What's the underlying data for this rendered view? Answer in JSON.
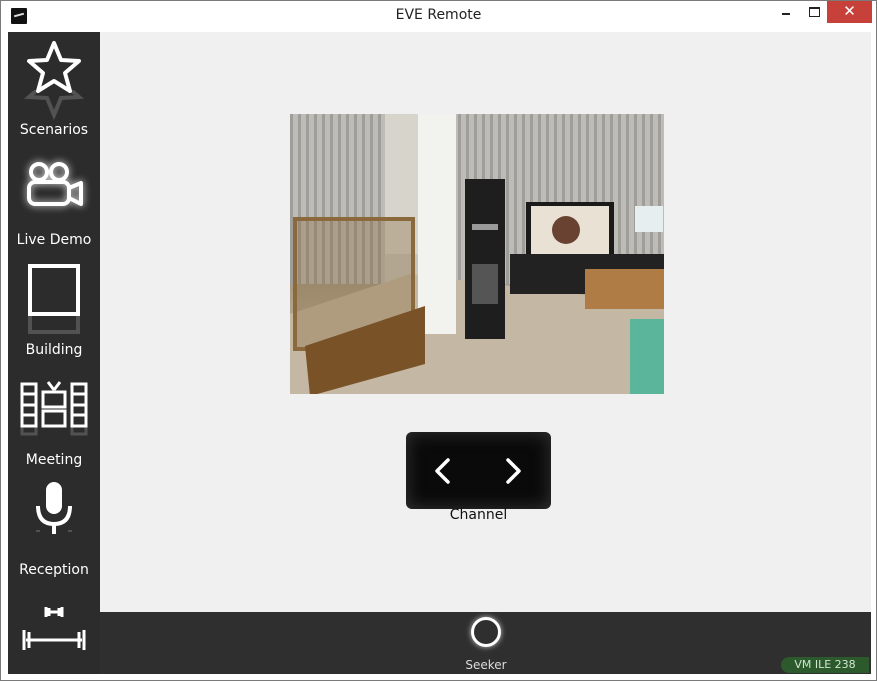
{
  "window": {
    "title": "EVE Remote",
    "close_glyph": "✕"
  },
  "sidebar": {
    "items": [
      {
        "label": "Scenarios",
        "icon": "star-icon"
      },
      {
        "label": "Live Demo",
        "icon": "camera-icon"
      },
      {
        "label": "Building",
        "icon": "square-icon"
      },
      {
        "label": "Meeting",
        "icon": "tv-grid-icon"
      },
      {
        "label": "Reception",
        "icon": "microphone-icon"
      },
      {
        "label": "",
        "icon": "dumbbell-icon"
      }
    ]
  },
  "main": {
    "channel_label": "Channel",
    "channel_prev_icon": "chevron-left-icon",
    "channel_next_icon": "chevron-right-icon"
  },
  "bottombar": {
    "seeker_label": "Seeker",
    "seeker_icon": "ring-icon",
    "status_badge": "VM ILE 238"
  },
  "colors": {
    "sidebar_bg": "#2c2c2c",
    "content_bg": "#f0f0f0",
    "close_button": "#c7413a",
    "status_badge_bg": "#2c5a2c"
  }
}
